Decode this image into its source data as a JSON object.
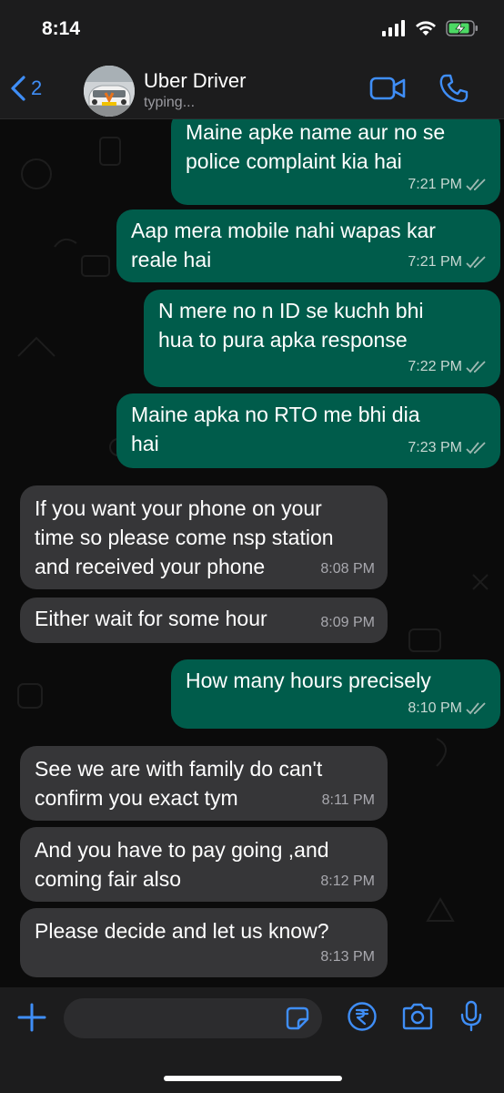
{
  "status_bar": {
    "time": "8:14"
  },
  "header": {
    "back_count": "2",
    "contact_name": "Uber Driver",
    "contact_status": "typing..."
  },
  "colors": {
    "accent": "#3f8ef7",
    "outgoing_bubble": "#005c4b",
    "incoming_bubble": "#363638",
    "battery": "#4cd964"
  },
  "messages": [
    {
      "direction": "out",
      "text": "Maine apke name aur no se\npolice complaint kia hai",
      "time": "7:21 PM",
      "read": true
    },
    {
      "direction": "out",
      "text": "Aap mera mobile nahi wapas kar\nreale hai",
      "time": "7:21 PM",
      "read": true
    },
    {
      "direction": "out",
      "text": "N mere no  n  ID se kuchh bhi\nhua to pura apka response",
      "time": "7:22 PM",
      "read": true
    },
    {
      "direction": "out",
      "text": "Maine apka no RTO me bhi dia\nhai",
      "time": "7:23 PM",
      "read": true
    },
    {
      "direction": "in",
      "text": "If you want your phone on your\ntime so please come nsp station\nand received  your phone",
      "time": "8:08 PM"
    },
    {
      "direction": "in",
      "text": "Either wait for some hour",
      "time": "8:09 PM"
    },
    {
      "direction": "out",
      "text": "How many hours precisely",
      "time": "8:10 PM",
      "read": true
    },
    {
      "direction": "in",
      "text": "See we are with family do can't\nconfirm  you exact  tym",
      "time": "8:11 PM"
    },
    {
      "direction": "in",
      "text": "And you have to pay going ,and\ncoming fair  also",
      "time": "8:12 PM"
    },
    {
      "direction": "in",
      "text": "Please decide  and let us know?",
      "time": "8:13 PM"
    }
  ],
  "input_bar": {
    "message_placeholder": ""
  }
}
